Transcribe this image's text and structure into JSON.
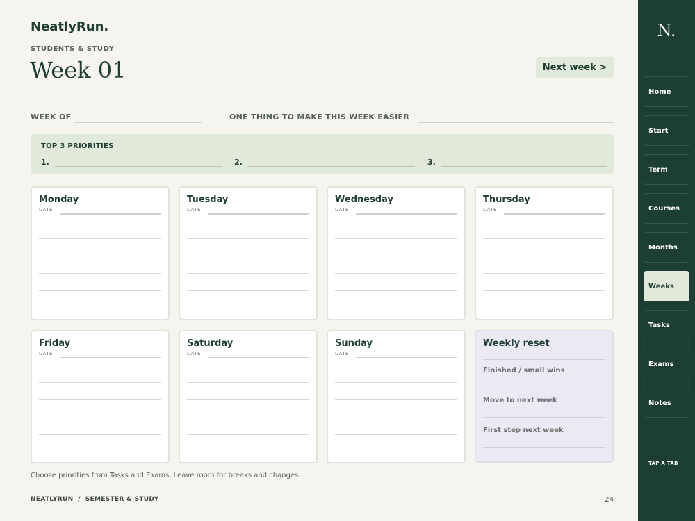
{
  "brand": "NeatlyRun.",
  "section_kicker": "STUDENTS & STUDY",
  "page_title": "Week 01",
  "next_week_label": "Next week >",
  "week_of_label": "WEEK OF",
  "easier_label": "ONE THING TO MAKE THIS WEEK EASIER",
  "priorities": {
    "title": "TOP 3 PRIORITIES",
    "numbers": [
      "1.",
      "2.",
      "3."
    ]
  },
  "date_label": "DATE",
  "days": [
    "Monday",
    "Tuesday",
    "Wednesday",
    "Thursday",
    "Friday",
    "Saturday",
    "Sunday"
  ],
  "weekly_reset": {
    "title": "Weekly reset",
    "items": [
      "Finished / small wins",
      "Move to next week",
      "First step next week"
    ]
  },
  "footnote": "Choose priorities from Tasks and Exams. Leave room for breaks and changes.",
  "footer": {
    "left": "NEATLYRUN  /  SEMESTER & STUDY",
    "page": "24"
  },
  "sidebar": {
    "logo": "N.",
    "items": [
      "Home",
      "Start",
      "Term",
      "Courses",
      "Months",
      "Weeks",
      "Tasks",
      "Exams",
      "Notes"
    ],
    "active": "Weeks",
    "hint": "TAP A TAB"
  },
  "colors": {
    "brand_green": "#1d3e33",
    "soft_green": "#e1e9da",
    "lavender": "#ebe9f4",
    "paper": "#f5f4ee"
  }
}
